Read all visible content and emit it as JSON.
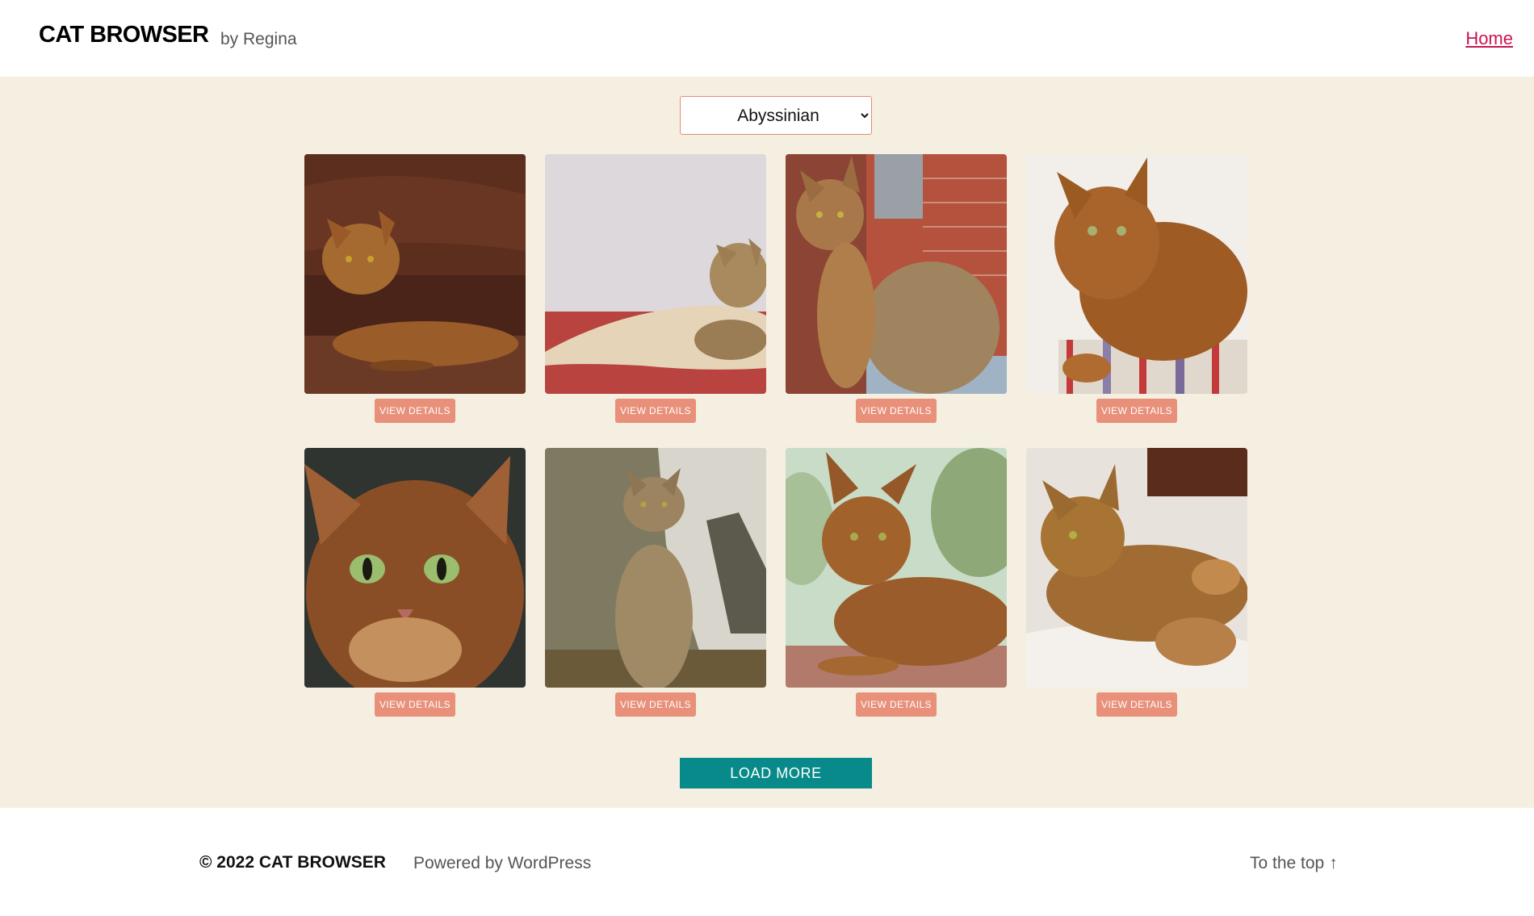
{
  "header": {
    "site_title": "CAT BROWSER",
    "tagline": "by Regina",
    "nav_home": "Home"
  },
  "filter": {
    "selected_breed": "Abyssinian"
  },
  "cards": [
    {
      "button_label": "VIEW DETAILS",
      "photo": "cat-photo-1"
    },
    {
      "button_label": "VIEW DETAILS",
      "photo": "cat-photo-2"
    },
    {
      "button_label": "VIEW DETAILS",
      "photo": "cat-photo-3"
    },
    {
      "button_label": "VIEW DETAILS",
      "photo": "cat-photo-4"
    },
    {
      "button_label": "VIEW DETAILS",
      "photo": "cat-photo-5"
    },
    {
      "button_label": "VIEW DETAILS",
      "photo": "cat-photo-6"
    },
    {
      "button_label": "VIEW DETAILS",
      "photo": "cat-photo-7"
    },
    {
      "button_label": "VIEW DETAILS",
      "photo": "cat-photo-8"
    }
  ],
  "load_more_label": "LOAD MORE",
  "footer": {
    "copyright": "© 2022 CAT BROWSER",
    "powered_by": "Powered by WordPress",
    "to_top": "To the top",
    "to_top_icon": "↑"
  },
  "colors": {
    "page_band": "#f5efe1",
    "accent_link": "#c8154f",
    "details_button": "#e8907a",
    "load_more_button": "#098a8a",
    "select_border": "#e58b75"
  }
}
